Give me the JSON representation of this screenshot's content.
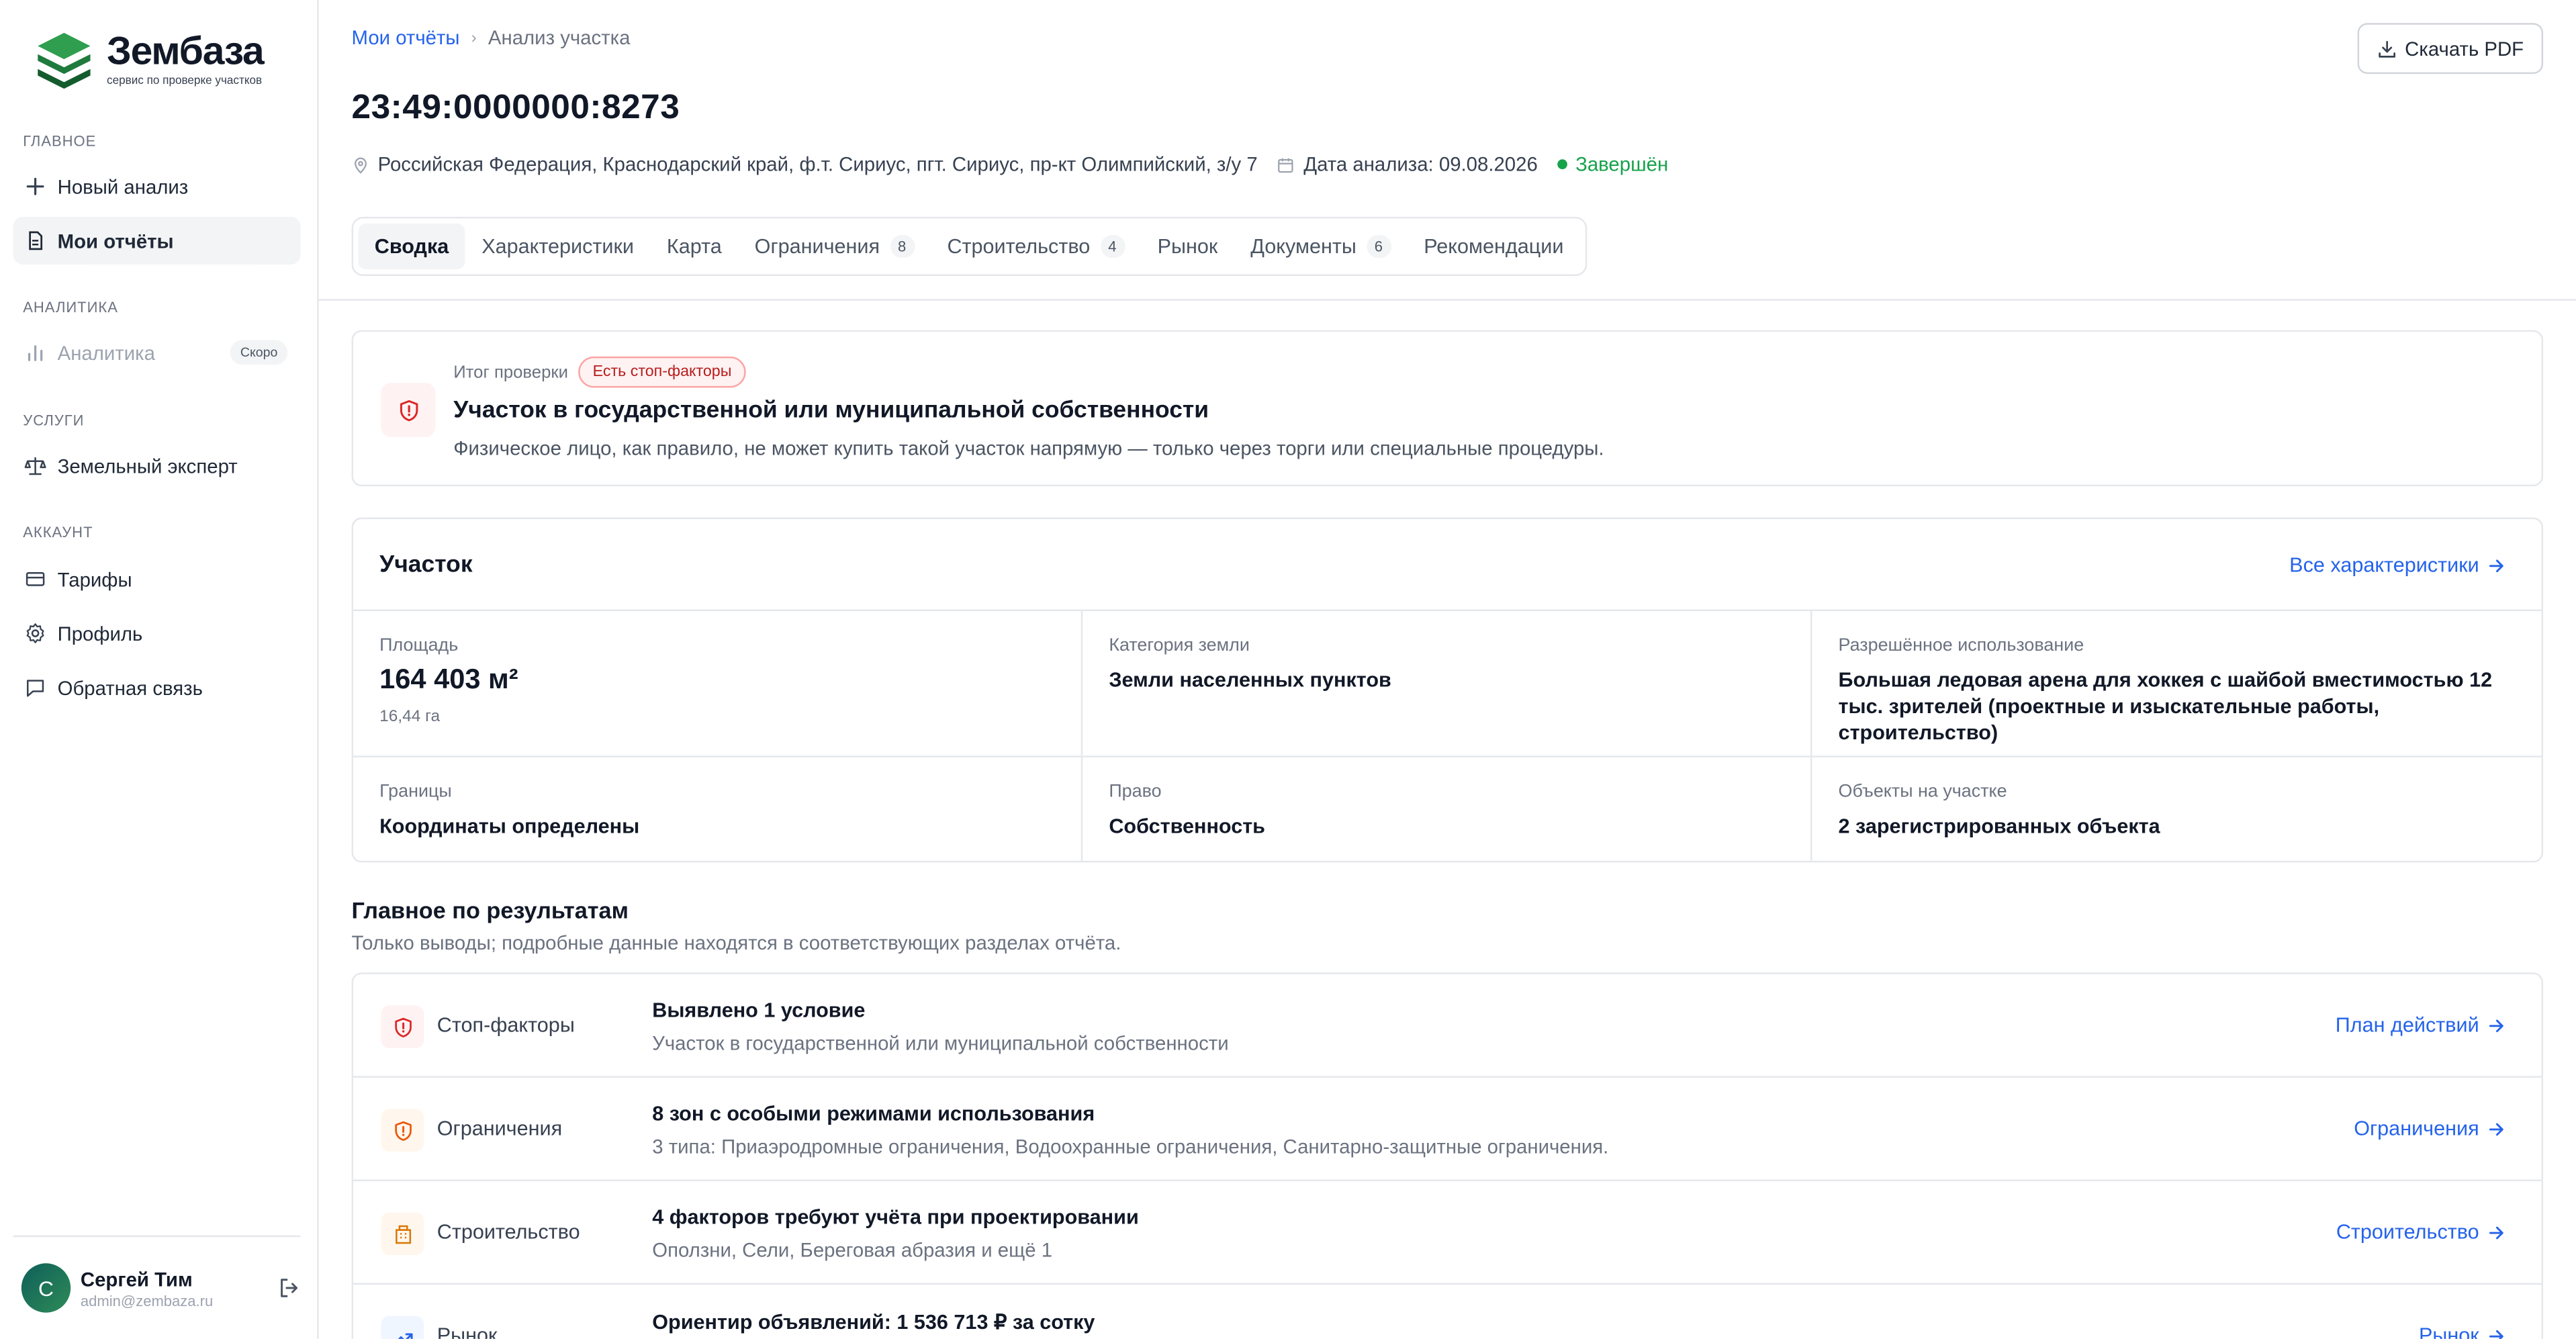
{
  "brand": {
    "name": "Зембаза",
    "tagline": "сервис по проверке участков"
  },
  "sidebar": {
    "sections": [
      {
        "title": "ГЛАВНОЕ",
        "items": [
          {
            "label": "Новый анализ",
            "icon": "plus-icon",
            "active": false
          },
          {
            "label": "Мои отчёты",
            "icon": "document-icon",
            "active": true
          }
        ]
      },
      {
        "title": "АНАЛИТИКА",
        "items": [
          {
            "label": "Аналитика",
            "icon": "bar-chart-icon",
            "badge": "Скоро",
            "disabled": true
          }
        ]
      },
      {
        "title": "УСЛУГИ",
        "items": [
          {
            "label": "Земельный эксперт",
            "icon": "scales-icon"
          }
        ]
      },
      {
        "title": "АККАУНТ",
        "items": [
          {
            "label": "Тарифы",
            "icon": "credit-card-icon"
          },
          {
            "label": "Профиль",
            "icon": "gear-icon"
          },
          {
            "label": "Обратная связь",
            "icon": "message-icon"
          }
        ]
      }
    ]
  },
  "user": {
    "initial": "С",
    "name": "Сергей Тим",
    "email": "admin@zembaza.ru"
  },
  "breadcrumb": {
    "parent": "Мои отчёты",
    "current": "Анализ участка"
  },
  "download_label": "Скачать PDF",
  "page_title": "23:49:0000000:8273",
  "meta": {
    "address": "Российская Федерация, Краснодарский край, ф.т. Сириус, пгт. Сириус, пр-кт Олимпийский, з/у 7",
    "date": "Дата анализа: 09.08.2026",
    "status": "Завершён",
    "status_color": "#16a34a"
  },
  "tabs": [
    {
      "label": "Сводка",
      "active": true
    },
    {
      "label": "Характеристики"
    },
    {
      "label": "Карта"
    },
    {
      "label": "Ограничения",
      "count": "8"
    },
    {
      "label": "Строительство",
      "count": "4"
    },
    {
      "label": "Рынок"
    },
    {
      "label": "Документы",
      "count": "6"
    },
    {
      "label": "Рекомендации"
    }
  ],
  "alert": {
    "label": "Итог проверки",
    "badge": "Есть стоп-факторы",
    "title": "Участок в государственной или муниципальной собственности",
    "description": "Физическое лицо, как правило, не может купить такой участок напрямую — только через торги или специальные процедуры."
  },
  "parcel": {
    "title": "Участок",
    "link": "Все характеристики",
    "area_label": "Площадь",
    "area_value": "164 403 м²",
    "area_sub": "16,44 га",
    "category_label": "Категория земли",
    "category_value": "Земли населенных пунктов",
    "usage_label": "Разрешённое использование",
    "usage_value": "Большая ледовая арена для хоккея с шайбой вместимостью 12 тыс. зрителей (проектные и изыскательные работы, строительство)",
    "borders_label": "Границы",
    "borders_value": "Координаты определены",
    "right_label": "Право",
    "right_value": "Собственность",
    "objects_label": "Объекты на участке",
    "objects_value": "2 зарегистрированных объекта"
  },
  "results": {
    "title": "Главное по результатам",
    "subtitle": "Только выводы; подробные данные находятся в соответствующих разделах отчёта.",
    "rows": [
      {
        "name": "Стоп-факторы",
        "icon": "shield-alert-icon",
        "color": "#dc2626",
        "headline": "Выявлено 1 условие",
        "detail": "Участок в государственной или муниципальной собственности",
        "link": "План действий"
      },
      {
        "name": "Ограничения",
        "icon": "shield-alert-icon",
        "color": "#ea580c",
        "headline": "8 зон с особыми режимами использования",
        "detail": "3 типа: Приаэродромные ограничения, Водоохранные ограничения, Санитарно-защитные ограничения.",
        "link": "Ограничения"
      },
      {
        "name": "Строительство",
        "icon": "building-icon",
        "color": "#d97706",
        "headline": "4 факторов требуют учёта при проектировании",
        "detail": "Оползни, Сели, Береговая абразия и ещё 1",
        "link": "Строительство"
      },
      {
        "name": "Рынок",
        "icon": "trend-up-icon",
        "color": "#2563eb",
        "headline": "Ориентир объявлений: 1 536 713 ₽ за сотку",
        "detail": "",
        "link": "Рынок"
      }
    ]
  }
}
